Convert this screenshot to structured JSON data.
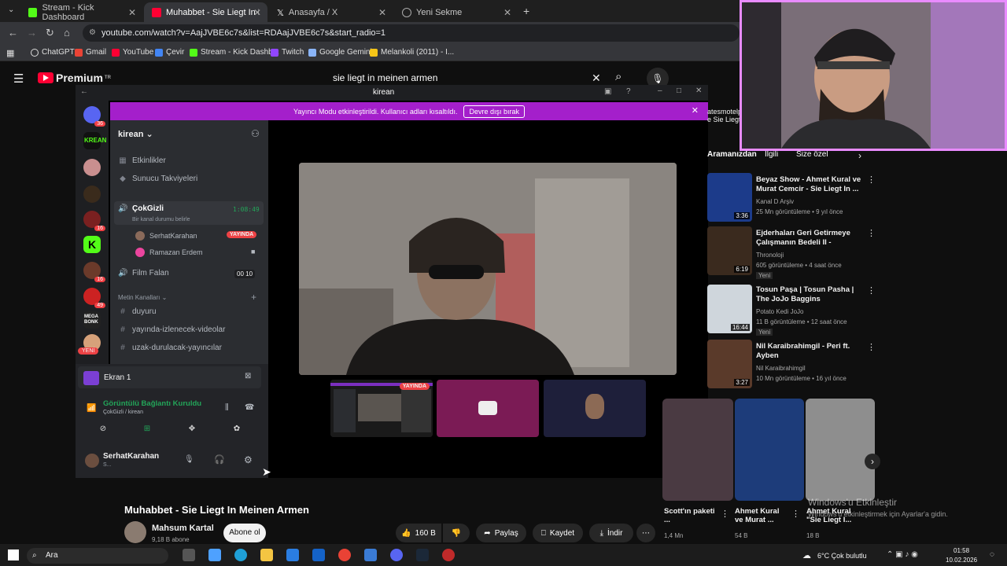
{
  "browser": {
    "tabs": [
      {
        "label": "Stream - Kick Dashboard"
      },
      {
        "label": "Muhabbet - Sie Liegt In Meinen"
      },
      {
        "label": "Anasayfa / X"
      },
      {
        "label": "Yeni Sekme"
      }
    ],
    "url": "youtube.com/watch?v=AajJVBE6c7s&list=RDAajJVBE6c7s&start_radio=1",
    "bookmarks": [
      "ChatGPT",
      "Gmail",
      "YouTube",
      "Çevir",
      "Stream - Kick Dashb...",
      "Twitch",
      "Google Gemini",
      "Melankoli (2011) - I..."
    ]
  },
  "youtube": {
    "logo": "Premium",
    "logo_sup": "TR",
    "search_query": "sie liegt in meinen armen",
    "video_title": "Muhabbet - Sie Liegt In Meinen Armen",
    "channel_name": "Mahsum Kartal",
    "subscribers": "9,18 B abone",
    "subscribe_label": "Abone ol",
    "likes": "160 B",
    "share_label": "Paylaş",
    "save_label": "Kaydet",
    "download_label": "İndir",
    "chips": [
      "Aramanızdan",
      "İlgili",
      "Size özel"
    ],
    "recommendations": [
      {
        "title": "Beyaz Show - Ahmet Kural ve Murat Cemcir - Sie Liegt In ...",
        "channel": "Kanal D Arşiv",
        "meta": "25 Mn görüntüleme • 9 yıl önce",
        "duration": "3:36",
        "badge": ""
      },
      {
        "title": "Ejderhaları Geri Getirmeye Çalışmanın Bedeli II -",
        "channel": "Thronoloji",
        "meta": "605 görüntüleme • 4 saat önce",
        "duration": "6:19",
        "badge": "Yeni"
      },
      {
        "title": "Tosun Paşa | Tosun Pasha | The JoJo Baggins",
        "channel": "Potato Kedi JoJo",
        "meta": "11 B görüntüleme • 12 saat önce",
        "duration": "16:44",
        "badge": "Yeni"
      },
      {
        "title": "Nil Karaibrahimgil - Peri ft. Ayben",
        "channel": "Nil Karaibrahimgil",
        "meta": "10 Mn görüntüleme • 16 yıl önce",
        "duration": "3:27",
        "badge": ""
      }
    ],
    "shorts": [
      {
        "title": "Scott'ın paketi ...",
        "views": "1,4 Mn"
      },
      {
        "title": "Ahmet Kural ve Murat ...",
        "views": "54 B"
      },
      {
        "title": "Ahmet Kural \"Sie Liegt I...",
        "views": "18 B"
      }
    ],
    "watermark_line1": "Windows'u Etkinleştir",
    "watermark_line2": "Windows'u etkinleştirmek için Ayarlar'a gidin."
  },
  "discord": {
    "window_title": "kirean",
    "banner_text": "Yayıncı Modu etkinleştirildi. Kullanıcı adları kısaltıldı.",
    "banner_button": "Devre dışı bırak",
    "server_name": "kirean",
    "channels": {
      "events": "Etkinlikler",
      "boosts": "Sunucu Takviyeleri",
      "voice1": "ÇokGizli",
      "voice1_time": "1:08:49",
      "voice1_status": "Bir kanal durumu belirle",
      "member1": "SerhatKarahan",
      "live_badge": "YAYINDA",
      "member2": "Ramazan Erdem",
      "voice2": "Film Falan",
      "voice2_a": "00",
      "voice2_b": "10",
      "text_category": "Metin Kanalları",
      "text1": "duyuru",
      "text2": "yayında-izlenecek-videolar",
      "text3": "uzak-durulacak-yayıncılar"
    },
    "screen_label": "Ekran 1",
    "connection_status": "Görüntülü Bağlantı Kuruldu",
    "connection_sub": "ÇokGizli / kirean",
    "user_name": "SerhatKarahan",
    "user_sub": "S...",
    "tile_live_badge": "YAYINDA",
    "server_badges": [
      "36",
      "16",
      "49"
    ],
    "new_badge": "YENİ"
  },
  "taskbar": {
    "search_label": "Ara",
    "weather": "6°C Çok bulutlu",
    "time": "01:58",
    "date": "10.02.2026"
  },
  "colors": {
    "discord_banner": "#a41fcb",
    "live_red": "#ed4245",
    "youtube_red": "#ff0033",
    "webcam_border": "#e98bff"
  }
}
